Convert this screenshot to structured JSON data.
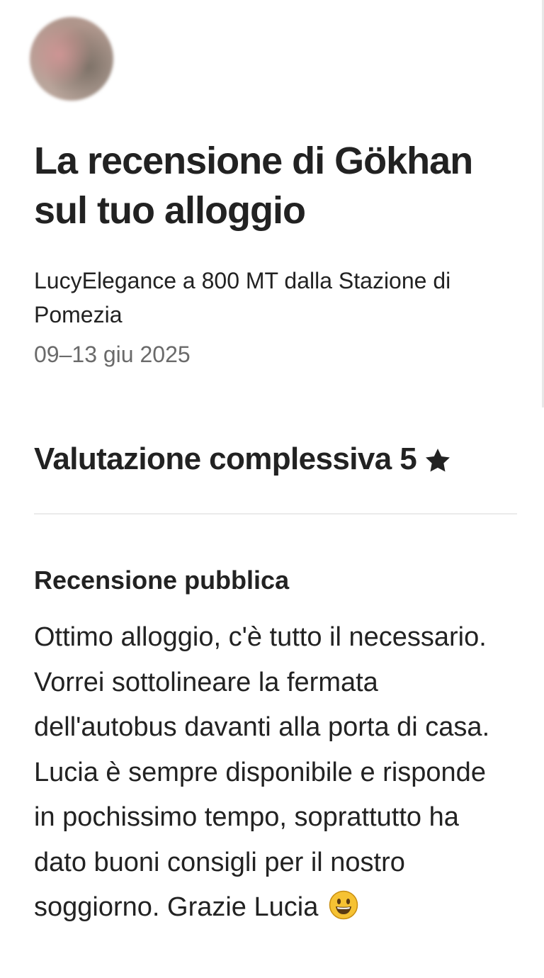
{
  "header": {
    "title": "La recensione di Gökhan sul tuo alloggio",
    "listing_name": "LucyElegance a 800 MT dalla Stazione di Pomezia",
    "dates": "09–13 giu 2025"
  },
  "rating": {
    "label": "Valutazione complessiva 5",
    "value": 5,
    "icon": "star-icon"
  },
  "public_review": {
    "heading": "Recensione pubblica",
    "text": "Ottimo alloggio, c'è tutto il necessario. Vorrei sottolineare la fermata dell'autobus davanti alla porta di casa. Lucia è sempre disponibile e risponde in pochissimo tempo, soprattutto ha dato buoni consigli per il nostro soggiorno. Grazie Lucia",
    "trailing_icon": "smiley-emoji-icon"
  },
  "colors": {
    "text_primary": "#222222",
    "text_secondary": "#6a6a6a",
    "divider": "#ebebeb",
    "emoji_fill": "#f6c233"
  }
}
